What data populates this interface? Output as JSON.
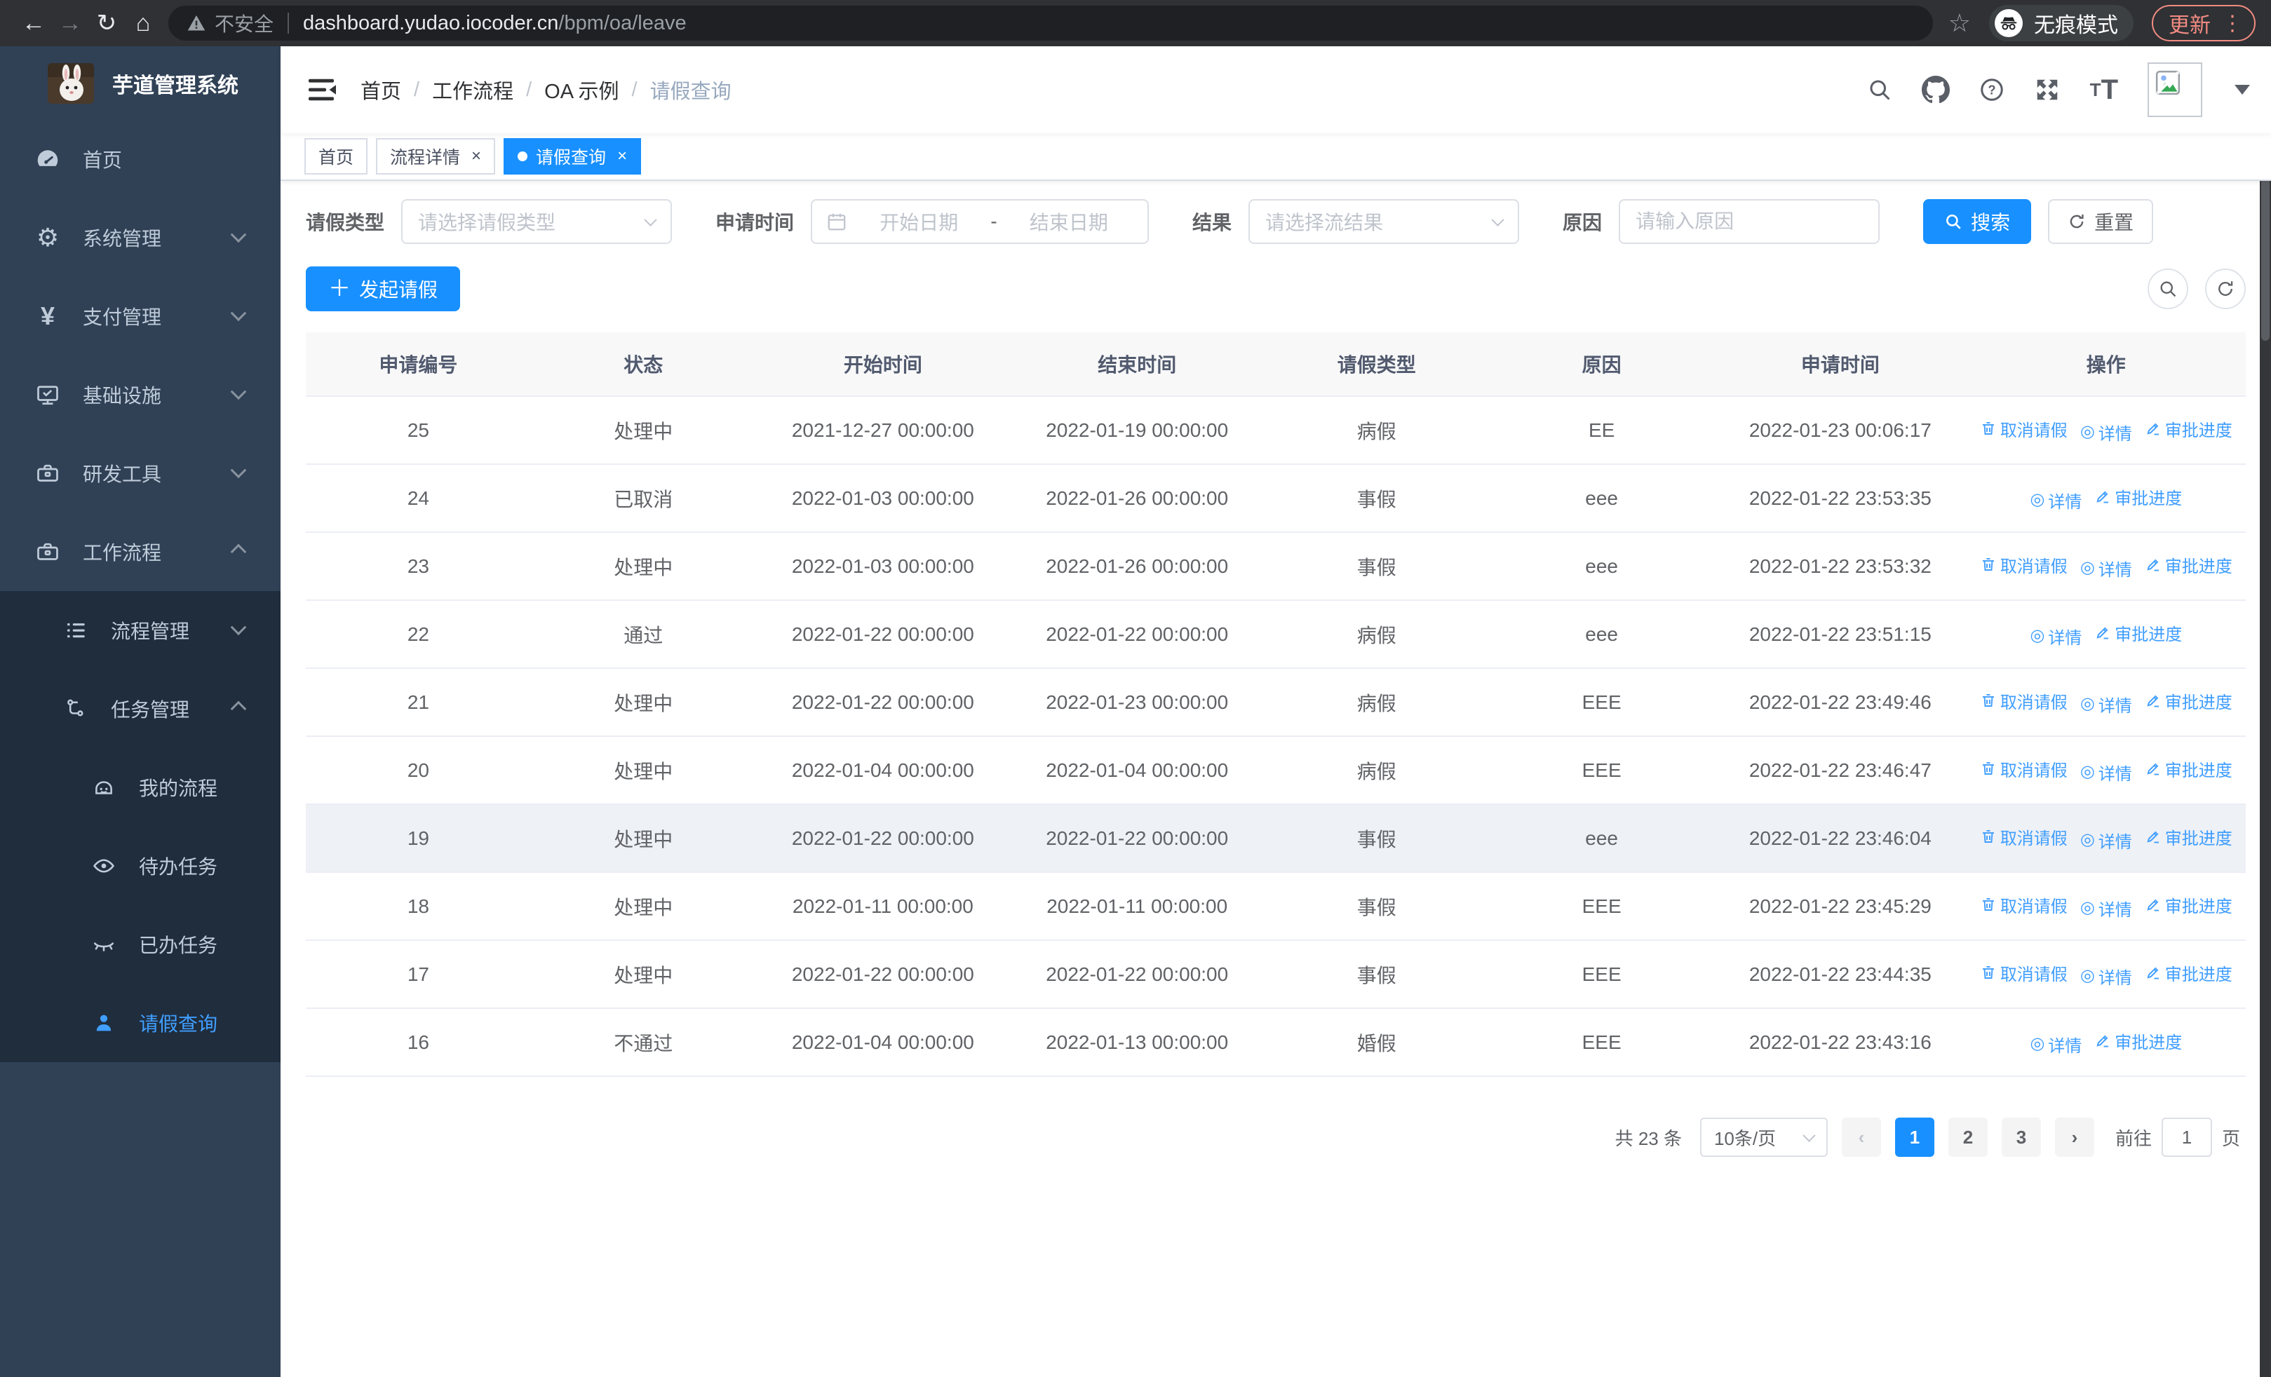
{
  "browser": {
    "security_label": "不安全",
    "url_host": "dashboard.yudao.iocoder.cn",
    "url_path": "/bpm/oa/leave",
    "incognito_label": "无痕模式",
    "update_label": "更新"
  },
  "sidebar": {
    "logo_title": "芋道管理系统",
    "items": [
      {
        "label": "首页",
        "level": 1,
        "icon": "gauge"
      },
      {
        "label": "系统管理",
        "level": 1,
        "icon": "gear",
        "chevron": "down"
      },
      {
        "label": "支付管理",
        "level": 1,
        "icon": "yen",
        "chevron": "down"
      },
      {
        "label": "基础设施",
        "level": 1,
        "icon": "monitor",
        "chevron": "down"
      },
      {
        "label": "研发工具",
        "level": 1,
        "icon": "toolbox",
        "chevron": "down"
      },
      {
        "label": "工作流程",
        "level": 1,
        "icon": "toolbox",
        "chevron": "up"
      },
      {
        "label": "流程管理",
        "level": 2,
        "icon": "list",
        "chevron": "down"
      },
      {
        "label": "任务管理",
        "level": 2,
        "icon": "branch",
        "chevron": "up"
      },
      {
        "label": "我的流程",
        "level": 3,
        "icon": "robot"
      },
      {
        "label": "待办任务",
        "level": 3,
        "icon": "eye"
      },
      {
        "label": "已办任务",
        "level": 3,
        "icon": "eye-closed"
      },
      {
        "label": "请假查询",
        "level": 3,
        "icon": "user",
        "active": true
      }
    ]
  },
  "navbar": {
    "breadcrumb": [
      "首页",
      "工作流程",
      "OA 示例",
      "请假查询"
    ],
    "separator": "/"
  },
  "tabs": [
    {
      "label": "首页",
      "closable": false,
      "active": false
    },
    {
      "label": "流程详情",
      "closable": true,
      "active": false
    },
    {
      "label": "请假查询",
      "closable": true,
      "active": true
    }
  ],
  "filters": {
    "leave_type_label": "请假类型",
    "leave_type_placeholder": "请选择请假类型",
    "apply_time_label": "申请时间",
    "date_start_placeholder": "开始日期",
    "date_separator": "-",
    "date_end_placeholder": "结束日期",
    "result_label": "结果",
    "result_placeholder": "请选择流结果",
    "reason_label": "原因",
    "reason_placeholder": "请输入原因",
    "search_button": "搜索",
    "reset_button": "重置"
  },
  "toolbar": {
    "create_button": "发起请假"
  },
  "table": {
    "columns": [
      "申请编号",
      "状态",
      "开始时间",
      "结束时间",
      "请假类型",
      "原因",
      "申请时间",
      "操作"
    ],
    "action_labels": {
      "cancel": "取消请假",
      "detail": "详情",
      "progress": "审批进度"
    },
    "rows": [
      {
        "id": "25",
        "status": "处理中",
        "start": "2021-12-27 00:00:00",
        "end": "2022-01-19 00:00:00",
        "type": "病假",
        "reason": "EE",
        "applied": "2022-01-23 00:06:17",
        "actions": [
          "cancel",
          "detail",
          "progress"
        ]
      },
      {
        "id": "24",
        "status": "已取消",
        "start": "2022-01-03 00:00:00",
        "end": "2022-01-26 00:00:00",
        "type": "事假",
        "reason": "eee",
        "applied": "2022-01-22 23:53:35",
        "actions": [
          "detail",
          "progress"
        ]
      },
      {
        "id": "23",
        "status": "处理中",
        "start": "2022-01-03 00:00:00",
        "end": "2022-01-26 00:00:00",
        "type": "事假",
        "reason": "eee",
        "applied": "2022-01-22 23:53:32",
        "actions": [
          "cancel",
          "detail",
          "progress"
        ]
      },
      {
        "id": "22",
        "status": "通过",
        "start": "2022-01-22 00:00:00",
        "end": "2022-01-22 00:00:00",
        "type": "病假",
        "reason": "eee",
        "applied": "2022-01-22 23:51:15",
        "actions": [
          "detail",
          "progress"
        ]
      },
      {
        "id": "21",
        "status": "处理中",
        "start": "2022-01-22 00:00:00",
        "end": "2022-01-23 00:00:00",
        "type": "病假",
        "reason": "EEE",
        "applied": "2022-01-22 23:49:46",
        "actions": [
          "cancel",
          "detail",
          "progress"
        ]
      },
      {
        "id": "20",
        "status": "处理中",
        "start": "2022-01-04 00:00:00",
        "end": "2022-01-04 00:00:00",
        "type": "病假",
        "reason": "EEE",
        "applied": "2022-01-22 23:46:47",
        "actions": [
          "cancel",
          "detail",
          "progress"
        ]
      },
      {
        "id": "19",
        "status": "处理中",
        "start": "2022-01-22 00:00:00",
        "end": "2022-01-22 00:00:00",
        "type": "事假",
        "reason": "eee",
        "applied": "2022-01-22 23:46:04",
        "actions": [
          "cancel",
          "detail",
          "progress"
        ],
        "highlighted": true
      },
      {
        "id": "18",
        "status": "处理中",
        "start": "2022-01-11 00:00:00",
        "end": "2022-01-11 00:00:00",
        "type": "事假",
        "reason": "EEE",
        "applied": "2022-01-22 23:45:29",
        "actions": [
          "cancel",
          "detail",
          "progress"
        ]
      },
      {
        "id": "17",
        "status": "处理中",
        "start": "2022-01-22 00:00:00",
        "end": "2022-01-22 00:00:00",
        "type": "事假",
        "reason": "EEE",
        "applied": "2022-01-22 23:44:35",
        "actions": [
          "cancel",
          "detail",
          "progress"
        ]
      },
      {
        "id": "16",
        "status": "不通过",
        "start": "2022-01-04 00:00:00",
        "end": "2022-01-13 00:00:00",
        "type": "婚假",
        "reason": "EEE",
        "applied": "2022-01-22 23:43:16",
        "actions": [
          "detail",
          "progress"
        ]
      }
    ]
  },
  "pagination": {
    "total_label": "共 23 条",
    "page_size": "10条/页",
    "prev": "‹",
    "next": "›",
    "pages": [
      "1",
      "2",
      "3"
    ],
    "current": "1",
    "goto_label": "前往",
    "goto_value": "1",
    "goto_suffix": "页"
  },
  "colors": {
    "primary": "#1890ff",
    "link": "#409eff",
    "sidebar_bg": "#304156",
    "submenu_bg": "#1f2d3d",
    "update_badge": "#f28b82",
    "table_header_bg": "#f8f8f9",
    "row_hover_bg": "#eef1f6"
  }
}
